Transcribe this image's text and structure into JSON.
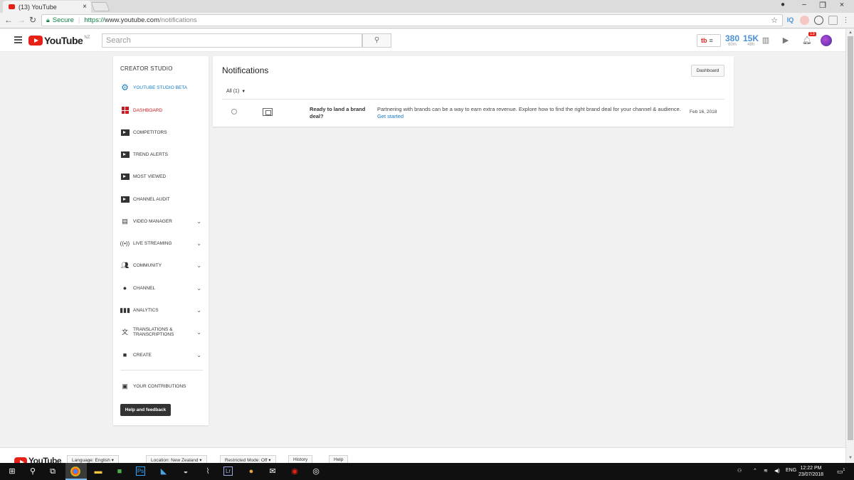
{
  "browser": {
    "tab_title": "(13) YouTube",
    "tab_close": "×",
    "secure_label": "Secure",
    "url_scheme": "https://",
    "url_host": "www.youtube.com",
    "url_path": "/notifications",
    "window_controls": [
      "−",
      "❐",
      "×"
    ],
    "extensions": [
      "IQ",
      "",
      "",
      "",
      ""
    ]
  },
  "masthead": {
    "logo_text": "YouTube",
    "country": "NZ",
    "search_placeholder": "Search",
    "tubebuddy_label": "tb",
    "stat1_value": "380",
    "stat1_label": "60m",
    "stat2_value": "15K",
    "stat2_label": "48h",
    "notification_count": "13"
  },
  "sidebar": {
    "title": "CREATOR STUDIO",
    "items": [
      {
        "label": "YOUTUBE STUDIO BETA",
        "icon": "gear-icon"
      },
      {
        "label": "DASHBOARD",
        "icon": "dashboard-icon"
      },
      {
        "label": "COMPETITORS",
        "icon": "tubebuddy-icon"
      },
      {
        "label": "TREND ALERTS",
        "icon": "tubebuddy-icon"
      },
      {
        "label": "MOST VIEWED",
        "icon": "tubebuddy-icon"
      },
      {
        "label": "CHANNEL AUDIT",
        "icon": "tubebuddy-icon"
      },
      {
        "label": "VIDEO MANAGER",
        "icon": "video-manager-icon"
      },
      {
        "label": "LIVE STREAMING",
        "icon": "live-icon"
      },
      {
        "label": "COMMUNITY",
        "icon": "people-icon"
      },
      {
        "label": "CHANNEL",
        "icon": "account-icon"
      },
      {
        "label": "ANALYTICS",
        "icon": "bar-chart-icon"
      },
      {
        "label": "TRANSLATIONS & TRANSCRIPTIONS",
        "icon": "translate-icon"
      },
      {
        "label": "CREATE",
        "icon": "video-camera-icon"
      },
      {
        "label": "YOUR CONTRIBUTIONS",
        "icon": "translate-box-icon"
      }
    ],
    "help_label": "Help and feedback"
  },
  "notifications": {
    "title": "Notifications",
    "dashboard_button": "Dashboard",
    "filter_label": "All (1)",
    "items": [
      {
        "title": "Ready to land a brand deal?",
        "body": "Partnering with brands can be a way to earn extra revenue. Explore how to find the right brand deal for your channel & audience.",
        "link": "Get started",
        "date": "Feb 16, 2018"
      }
    ]
  },
  "footer": {
    "logo_text": "YouTube",
    "language": "Language: English",
    "location": "Location: New Zealand",
    "restricted": "Restricted Mode: Off",
    "history": "History",
    "help": "Help"
  },
  "taskbar": {
    "language": "ENG",
    "time": "12:22 PM",
    "date": "23/07/2018",
    "action_center_count": "1"
  },
  "colors": {
    "youtube_red": "#e62117",
    "link_blue": "#167ac6",
    "dashboard_red": "#cc181e"
  }
}
